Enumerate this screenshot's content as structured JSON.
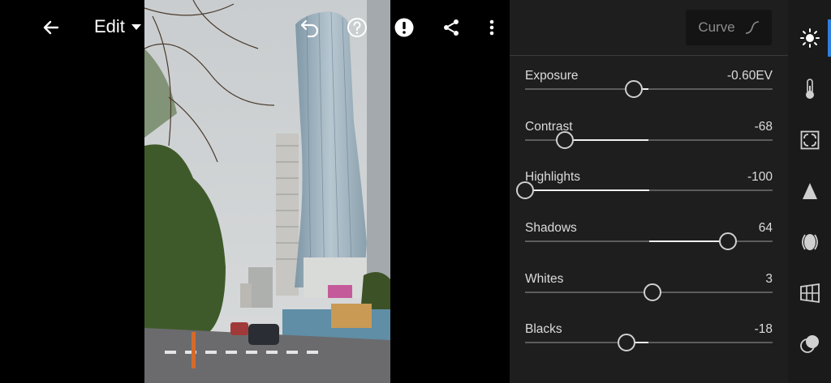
{
  "header": {
    "title": "Edit"
  },
  "panel": {
    "curve_label": "Curve"
  },
  "sliders": [
    {
      "label": "Exposure",
      "value": "-0.60EV",
      "min": -5,
      "max": 5,
      "numeric": -0.6
    },
    {
      "label": "Contrast",
      "value": "-68",
      "min": -100,
      "max": 100,
      "numeric": -68
    },
    {
      "label": "Highlights",
      "value": "-100",
      "min": -100,
      "max": 100,
      "numeric": -100
    },
    {
      "label": "Shadows",
      "value": "64",
      "min": -100,
      "max": 100,
      "numeric": 64
    },
    {
      "label": "Whites",
      "value": "3",
      "min": -100,
      "max": 100,
      "numeric": 3
    },
    {
      "label": "Blacks",
      "value": "-18",
      "min": -100,
      "max": 100,
      "numeric": -18
    }
  ],
  "rail": {
    "items": [
      "light-icon",
      "color-icon",
      "effects-icon",
      "detail-icon",
      "optics-icon",
      "geometry-icon",
      "presets-icon"
    ],
    "active": "light-icon"
  },
  "colors": {
    "accent": "#2f7ee0",
    "panel": "#1e1e1e"
  }
}
